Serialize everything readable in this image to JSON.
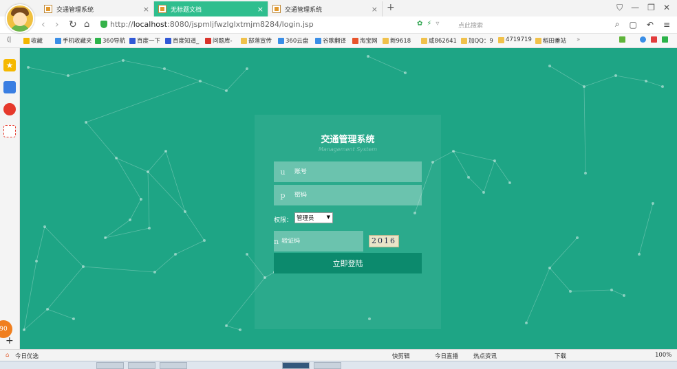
{
  "tabs": [
    {
      "label": "交通管理系统",
      "active": false
    },
    {
      "label": "无标题文档",
      "active": true
    },
    {
      "label": "交通管理系统",
      "active": false
    }
  ],
  "new_tab": "+",
  "window_controls": {
    "skin": "⛉",
    "minimize": "—",
    "restore": "❐",
    "close": "✕"
  },
  "address": {
    "url_prefix": "http://",
    "url_host": "localhost",
    "url_rest": ":8080/jspmljfwzlglxtmjm8284/login.jsp",
    "search_placeholder": "点此搜索"
  },
  "bookmarks": [
    {
      "label": "收藏",
      "color": "#f2b600"
    },
    {
      "label": "手机收藏夹",
      "color": "#3a8ee6"
    },
    {
      "label": "360导航",
      "color": "#2cb34a"
    },
    {
      "label": "百度一下",
      "color": "#3159d6"
    },
    {
      "label": "百度知道_",
      "color": "#3159d6"
    },
    {
      "label": "问题库-",
      "color": "#d9332b"
    },
    {
      "label": "部落宣传",
      "color": "#f0c14b"
    },
    {
      "label": "360云盘",
      "color": "#3a8ee6"
    },
    {
      "label": "谷歌翻译",
      "color": "#3a8ee6"
    },
    {
      "label": "淘宝网",
      "color": "#e8542c"
    },
    {
      "label": "新9618",
      "color": "#f0c14b"
    },
    {
      "label": "咸862641",
      "color": "#f0c14b"
    },
    {
      "label": "加QQ：9",
      "color": "#f0c14b"
    },
    {
      "label": "4719719",
      "color": "#f0c14b"
    },
    {
      "label": "稻田番站",
      "color": "#f0c14b"
    }
  ],
  "bookmarks_more": "»",
  "login": {
    "title": "交通管理系统",
    "subtitle": "Management System",
    "account_prefix": "u",
    "account_placeholder": "账号",
    "password_prefix": "p",
    "password_placeholder": "密码",
    "role_label": "权限：",
    "role_value": "管理员",
    "captcha_prefix": "n",
    "captcha_placeholder": "验证码",
    "captcha_code": "2016",
    "submit_label": "立即登陆"
  },
  "sidebar_badge": "90",
  "statusbar": {
    "left": "今日优选",
    "items": [
      "快剪辑",
      "今日直播",
      "热点资讯",
      "下载"
    ],
    "zoom": "100%"
  },
  "colors": {
    "content_bg": "#1ea585",
    "active_tab": "#2fbe8e",
    "login_button": "#0c8a6d"
  }
}
